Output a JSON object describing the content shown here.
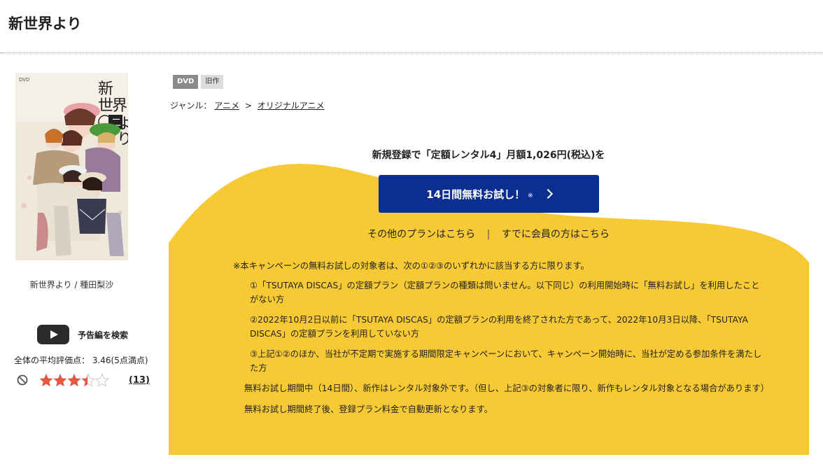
{
  "page": {
    "title": "新世界より"
  },
  "product": {
    "cover_title": "新世界より",
    "cover_volume": "二",
    "cover_logo": "DVD",
    "caption": "新世界より / 種田梨沙",
    "badges": [
      "DVD",
      "旧作"
    ],
    "genre": {
      "label": "ジャンル：",
      "primary": "アニメ",
      "separator": ">",
      "secondary": "オリジナルアニメ"
    }
  },
  "trailer": {
    "label": "予告編を検索"
  },
  "rating": {
    "summary": "全体の平均評価点： 3.46(5点満点)",
    "score": 3.46,
    "max": 5,
    "count": "(13)"
  },
  "campaign": {
    "signup_text": "新規登録で「定額レンタル4」月額1,026円(税込)を",
    "trial_button": "14日間無料お試し！",
    "trial_note": "※",
    "other_plans": "その他のプランはこちら",
    "separator": "|",
    "members": "すでに会員の方はこちら",
    "notes_head": "※本キャンペーンの無料お試しの対象者は、次の①②③のいずれかに該当する方に限ります。",
    "conditions": [
      "①「TSUTAYA DISCAS」の定額プラン（定額プランの種類は問いません。以下同じ）の利用開始時に「無料お試し」を利用したことがない方",
      "②2022年10月2日以前に「TSUTAYA DISCAS」の定額プランの利用を終了された方であって、2022年10月3日以降、「TSUTAYA DISCAS」の定額プランを利用していない方",
      "③上記①②のほか、当社が不定期で実施する期間限定キャンペーンにおいて、キャンペーン開始時に、当社が定める参加条件を満たした方"
    ],
    "para1": "無料お試し期間中（14日間）、新作はレンタル対象外です。（但し、上記③の対象者に限り、新作もレンタル対象となる場合があります）",
    "para2": "無料お試し期間終了後、登録プラン料金で自動更新となります。"
  },
  "colors": {
    "accent_blue": "#0b2f91",
    "campaign_yellow": "#f7ca35",
    "star": "#e8573f"
  }
}
